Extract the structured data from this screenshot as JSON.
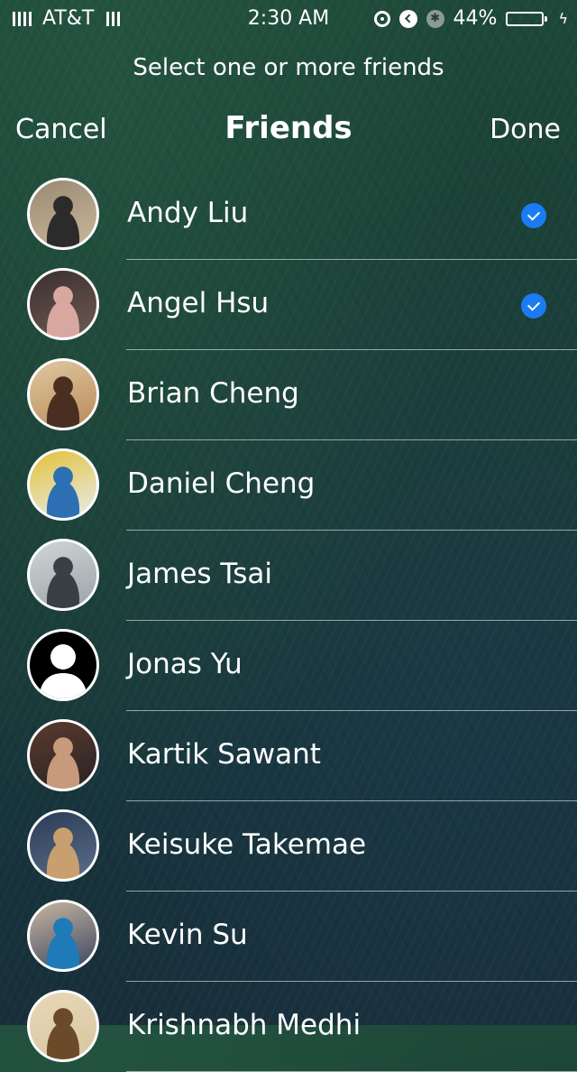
{
  "status_bar": {
    "carrier": "AT&T",
    "time": "2:30 AM",
    "battery_percent": "44%",
    "battery_level": 0.44,
    "battery_color": "#4cd964"
  },
  "header": {
    "prompt": "Select one or more friends",
    "title": "Friends",
    "cancel_label": "Cancel",
    "done_label": "Done"
  },
  "colors": {
    "check_accent": "#1a7bf2",
    "text": "#ffffff"
  },
  "friends": [
    {
      "name": "Andy Liu",
      "selected": true,
      "avatar": "photo"
    },
    {
      "name": "Angel Hsu",
      "selected": true,
      "avatar": "photo"
    },
    {
      "name": "Brian Cheng",
      "selected": false,
      "avatar": "photo"
    },
    {
      "name": "Daniel Cheng",
      "selected": false,
      "avatar": "photo"
    },
    {
      "name": "James Tsai",
      "selected": false,
      "avatar": "photo"
    },
    {
      "name": "Jonas Yu",
      "selected": false,
      "avatar": "default-silhouette"
    },
    {
      "name": "Kartik Sawant",
      "selected": false,
      "avatar": "photo"
    },
    {
      "name": "Keisuke Takemae",
      "selected": false,
      "avatar": "photo"
    },
    {
      "name": "Kevin Su",
      "selected": false,
      "avatar": "photo"
    },
    {
      "name": "Krishnabh Medhi",
      "selected": false,
      "avatar": "photo"
    }
  ]
}
